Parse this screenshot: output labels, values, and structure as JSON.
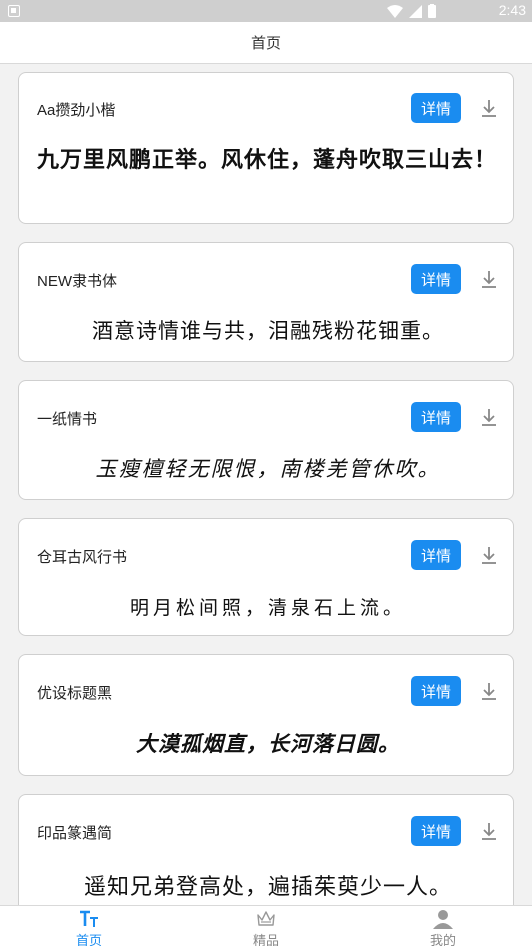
{
  "status_bar": {
    "time": "2:43"
  },
  "header": {
    "title": "首页"
  },
  "fonts": [
    {
      "name": "Aa攒劲小楷",
      "detail_label": "详情",
      "sample": "九万里风鹏正举。风休住，蓬舟吹取三山去！"
    },
    {
      "name": "NEW隶书体",
      "detail_label": "详情",
      "sample": "酒意诗情谁与共，泪融残粉花钿重。"
    },
    {
      "name": "一纸情书",
      "detail_label": "详情",
      "sample": "玉瘦檀轻无限恨，南楼羌管休吹。"
    },
    {
      "name": "仓耳古风行书",
      "detail_label": "详情",
      "sample": "明月松间照，清泉石上流。"
    },
    {
      "name": "优设标题黑",
      "detail_label": "详情",
      "sample": "大漠孤烟直，长河落日圆。"
    },
    {
      "name": "印品篆遇简",
      "detail_label": "详情",
      "sample": "遥知兄弟登高处，遍插茱萸少一人。"
    }
  ],
  "tabs": [
    {
      "label": "首页",
      "icon": "font-size-icon",
      "active": true
    },
    {
      "label": "精品",
      "icon": "crown-icon",
      "active": false
    },
    {
      "label": "我的",
      "icon": "user-icon",
      "active": false
    }
  ],
  "colors": {
    "accent": "#1a8cf0",
    "inactive": "#888888"
  }
}
